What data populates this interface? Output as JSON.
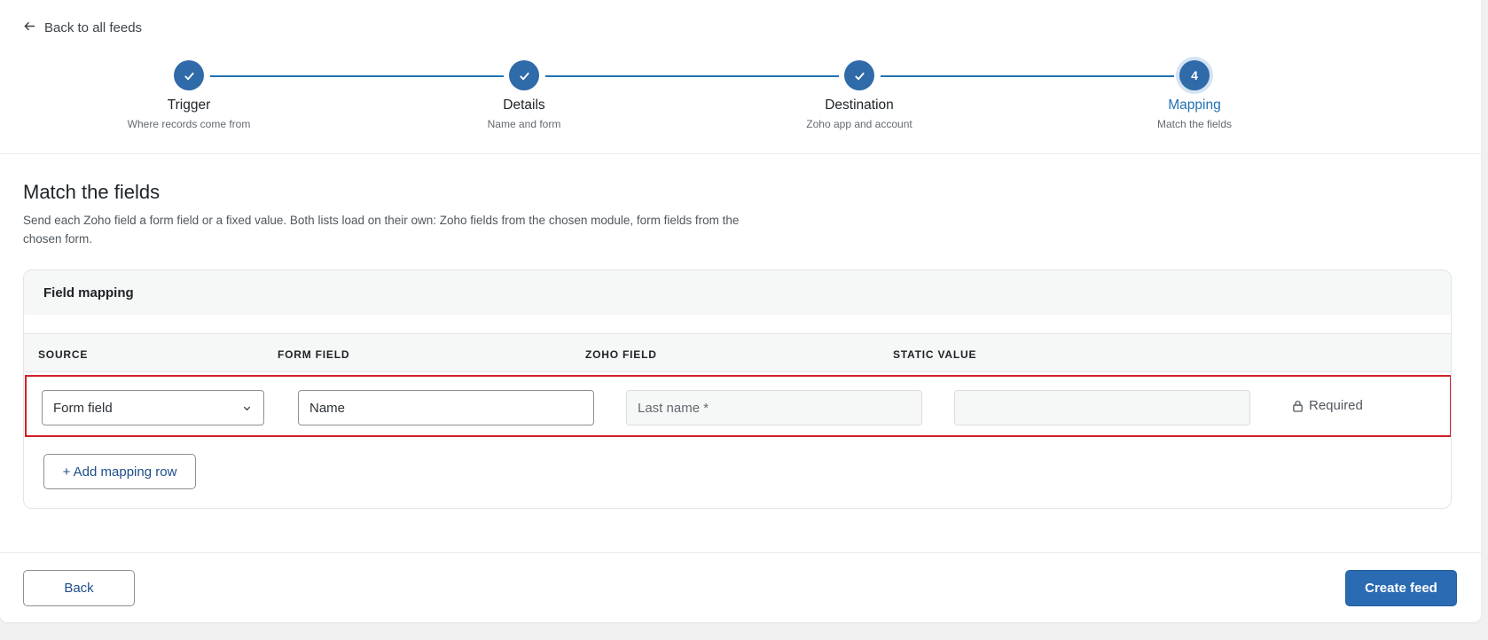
{
  "nav": {
    "back_to_feeds": "Back to all feeds"
  },
  "stepper": {
    "steps": [
      {
        "title": "Trigger",
        "subtitle": "Where records come from",
        "state": "done"
      },
      {
        "title": "Details",
        "subtitle": "Name and form",
        "state": "done"
      },
      {
        "title": "Destination",
        "subtitle": "Zoho app and account",
        "state": "done"
      },
      {
        "title": "Mapping",
        "subtitle": "Match the fields",
        "state": "current",
        "number": "4"
      }
    ]
  },
  "page": {
    "title": "Match the fields",
    "description": "Send each Zoho field a form field or a fixed value. Both lists load on their own: Zoho fields from the chosen module, form fields from the chosen form."
  },
  "mapping": {
    "card_title": "Field mapping",
    "columns": [
      "SOURCE",
      "FORM FIELD",
      "ZOHO FIELD",
      "STATIC VALUE"
    ],
    "rows": [
      {
        "source": "Form field",
        "form_field": "Name",
        "zoho_field": "Last name *",
        "static_value": "",
        "status": "Required"
      }
    ],
    "add_row_label": "+ Add mapping row"
  },
  "footer": {
    "back_label": "Back",
    "create_label": "Create feed"
  },
  "colors": {
    "accent": "#2f6aa9",
    "highlight": "#d0202a"
  }
}
